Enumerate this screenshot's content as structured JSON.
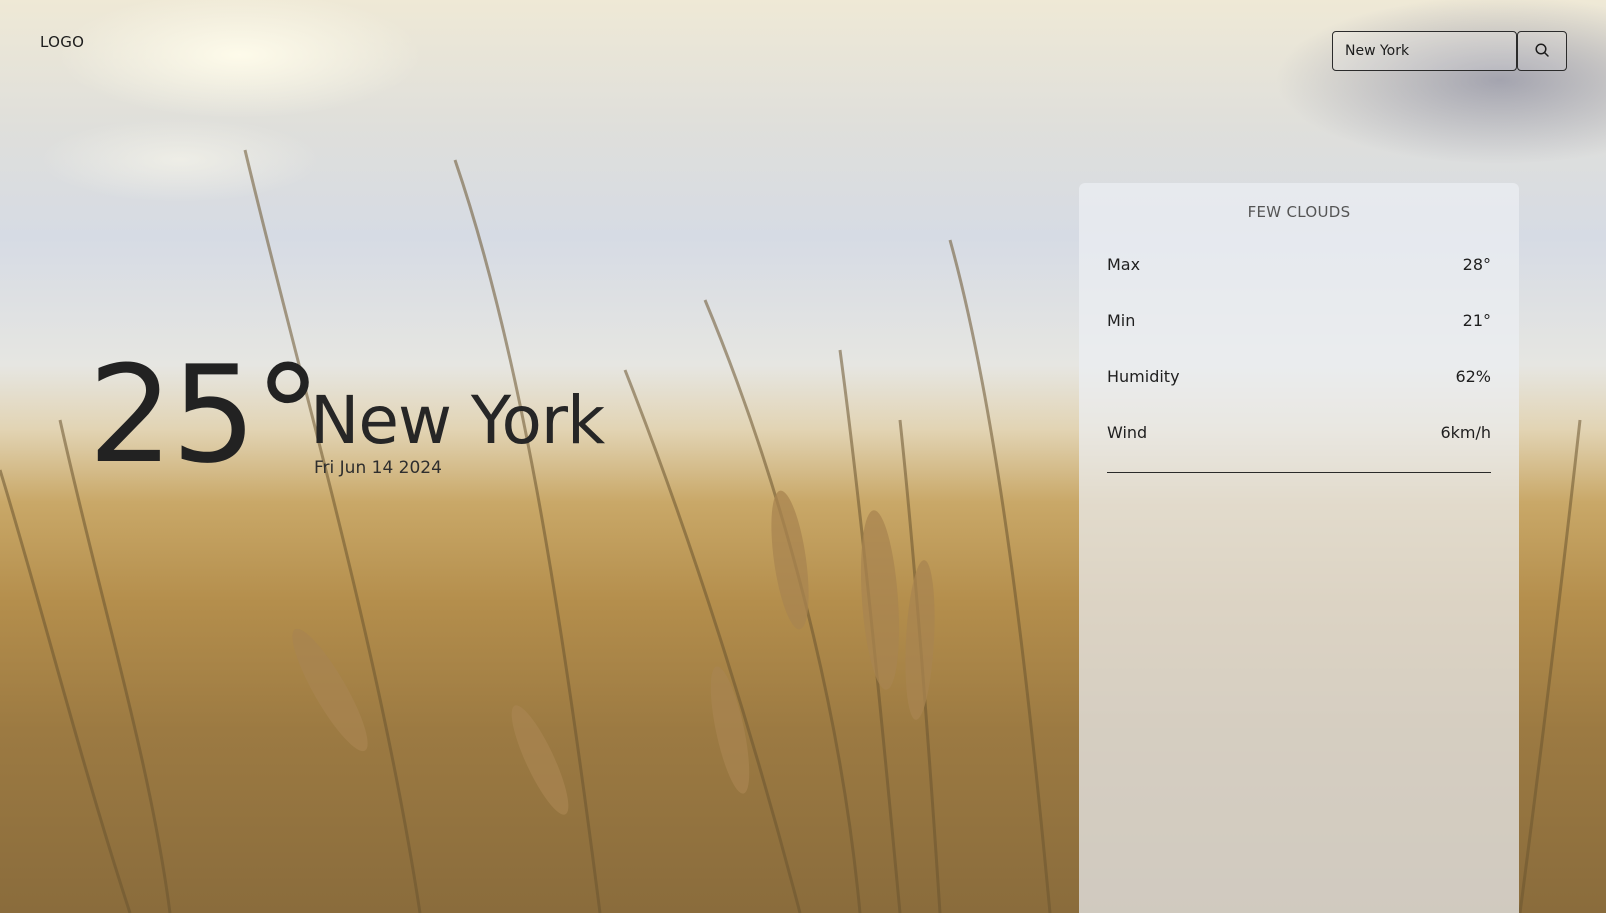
{
  "header": {
    "logo": "LOGO"
  },
  "search": {
    "value": "New York",
    "placeholder": "",
    "icon": "search-icon"
  },
  "current": {
    "temperature": "25°",
    "city": "New York",
    "date": "Fri Jun 14 2024"
  },
  "details": {
    "condition": "FEW CLOUDS",
    "rows": [
      {
        "label": "Max",
        "value": "28°"
      },
      {
        "label": "Min",
        "value": "21°"
      },
      {
        "label": "Humidity",
        "value": "62%"
      },
      {
        "label": "Wind",
        "value": "6km/h"
      }
    ]
  },
  "colors": {
    "text_dark": "#222222",
    "panel_bg": "#eceef2",
    "sky": "#d6dbe4",
    "field": "#b48e4c"
  }
}
